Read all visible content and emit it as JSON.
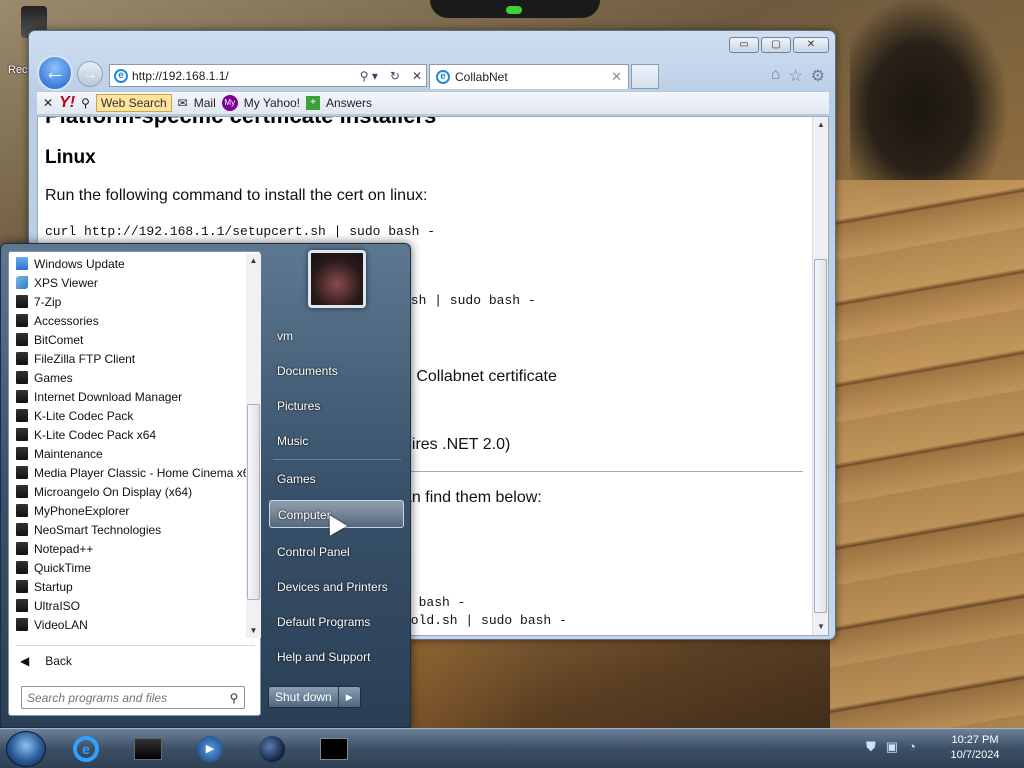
{
  "desktop": {
    "icon_label": "Rec"
  },
  "ie": {
    "window_controls": {
      "minimize": "▭",
      "maximize": "▢",
      "close": "✕"
    },
    "address_url": "http://192.168.1.1/",
    "address_search": "⚲ ▾",
    "address_refresh": "↻",
    "address_stop": "✕",
    "tab_title": "CollabNet",
    "tab_close": "✕",
    "tools": [
      "⌂",
      "☆",
      "⚙"
    ],
    "yahoo_toolbar": {
      "x": "✕",
      "logo": "Y!",
      "web_search_label": "Web Search",
      "mail_label": "Mail",
      "myyahoo_icon": "My",
      "myyahoo_label": "My Yahoo!",
      "answers_label": "Answers"
    },
    "page": {
      "heading_cut": "Platform-specific certificate installers",
      "h2_linux": "Linux",
      "p_linux": "Run the following command to install the cert on linux:",
      "code_linux": "curl http://192.168.1.1/setupcert.sh | sudo bash -",
      "code_partial2": ".sh | sudo bash -",
      "p_partial_collabnet": "e Collabnet certificate",
      "p_partial_net": "uires .NET 2.0)",
      "p_partial_find": "an find them below:",
      "code_partial3": "o bash -",
      "code_partial4": "_old.sh | sudo bash -"
    }
  },
  "start_menu": {
    "programs": [
      {
        "label": "Windows Update",
        "icon": "wu"
      },
      {
        "label": "XPS Viewer",
        "icon": "xps"
      },
      {
        "label": "7-Zip",
        "icon": "folder"
      },
      {
        "label": "Accessories",
        "icon": "folder"
      },
      {
        "label": "BitComet",
        "icon": "folder"
      },
      {
        "label": "FileZilla FTP Client",
        "icon": "folder"
      },
      {
        "label": "Games",
        "icon": "folder"
      },
      {
        "label": "Internet Download Manager",
        "icon": "folder"
      },
      {
        "label": "K-Lite Codec Pack",
        "icon": "folder"
      },
      {
        "label": "K-Lite Codec Pack x64",
        "icon": "folder"
      },
      {
        "label": "Maintenance",
        "icon": "folder"
      },
      {
        "label": "Media Player Classic - Home Cinema x6",
        "icon": "folder"
      },
      {
        "label": "Microangelo On Display (x64)",
        "icon": "folder"
      },
      {
        "label": "MyPhoneExplorer",
        "icon": "folder"
      },
      {
        "label": "NeoSmart Technologies",
        "icon": "folder"
      },
      {
        "label": "Notepad++",
        "icon": "folder"
      },
      {
        "label": "QuickTime",
        "icon": "folder"
      },
      {
        "label": "Startup",
        "icon": "folder"
      },
      {
        "label": "UltraISO",
        "icon": "folder"
      },
      {
        "label": "VideoLAN",
        "icon": "folder"
      }
    ],
    "back_icon": "◀",
    "back_label": "Back",
    "search_placeholder": "Search programs and files",
    "search_icon": "⚲",
    "right_items": [
      "vm",
      "Documents",
      "Pictures",
      "Music",
      "Games",
      "Computer",
      "Control Panel",
      "Devices and Printers",
      "Default Programs",
      "Help and Support"
    ],
    "selected_item": "Computer",
    "shutdown_label": "Shut down",
    "shutdown_arrow": "▶"
  },
  "taskbar": {
    "tray_icons": [
      "⛊",
      "▣",
      "◔"
    ],
    "time": "10:27 PM",
    "date": "10/7/2024"
  }
}
